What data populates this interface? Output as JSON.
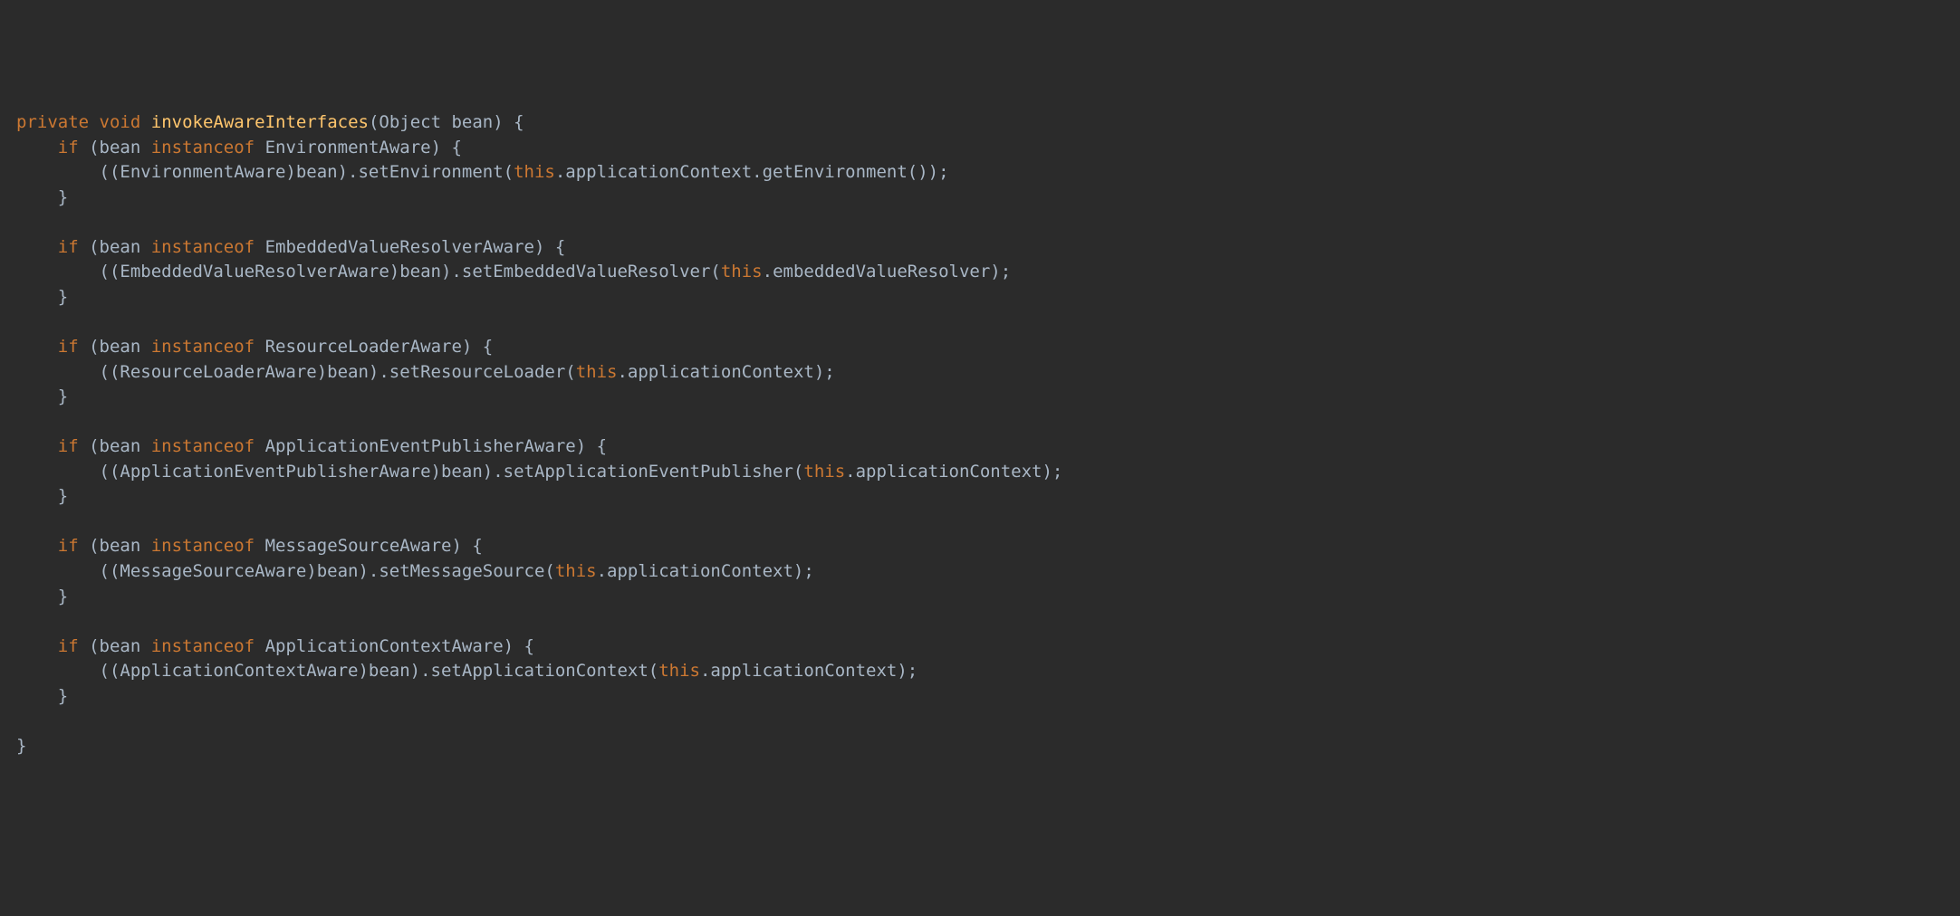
{
  "colors": {
    "background": "#2b2b2b",
    "default_text": "#a9b7c6",
    "keyword": "#cc7832",
    "method_decl": "#ffc66d",
    "indent_guide": "#444444"
  },
  "code": {
    "tokens": [
      [
        {
          "t": "private",
          "c": "kw-modifier"
        },
        {
          "t": " "
        },
        {
          "t": "void",
          "c": "kw-type"
        },
        {
          "t": " "
        },
        {
          "t": "invokeAwareInterfaces",
          "c": "method-decl"
        },
        {
          "t": "(Object bean) {"
        }
      ],
      [
        {
          "t": "    "
        },
        {
          "t": "if",
          "c": "kw-control"
        },
        {
          "t": " (bean "
        },
        {
          "t": "instanceof",
          "c": "kw-control"
        },
        {
          "t": " EnvironmentAware) {"
        }
      ],
      [
        {
          "t": "        ((EnvironmentAware)bean).setEnvironment("
        },
        {
          "t": "this",
          "c": "kw-this"
        },
        {
          "t": ".applicationContext.getEnvironment());"
        }
      ],
      [
        {
          "t": "    }"
        }
      ],
      [
        {
          "t": ""
        }
      ],
      [
        {
          "t": "    "
        },
        {
          "t": "if",
          "c": "kw-control"
        },
        {
          "t": " (bean "
        },
        {
          "t": "instanceof",
          "c": "kw-control"
        },
        {
          "t": " EmbeddedValueResolverAware) {"
        }
      ],
      [
        {
          "t": "        ((EmbeddedValueResolverAware)bean).setEmbeddedValueResolver("
        },
        {
          "t": "this",
          "c": "kw-this"
        },
        {
          "t": ".embeddedValueResolver);"
        }
      ],
      [
        {
          "t": "    }"
        }
      ],
      [
        {
          "t": ""
        }
      ],
      [
        {
          "t": "    "
        },
        {
          "t": "if",
          "c": "kw-control"
        },
        {
          "t": " (bean "
        },
        {
          "t": "instanceof",
          "c": "kw-control"
        },
        {
          "t": " ResourceLoaderAware) {"
        }
      ],
      [
        {
          "t": "        ((ResourceLoaderAware)bean).setResourceLoader("
        },
        {
          "t": "this",
          "c": "kw-this"
        },
        {
          "t": ".applicationContext);"
        }
      ],
      [
        {
          "t": "    }"
        }
      ],
      [
        {
          "t": ""
        }
      ],
      [
        {
          "t": "    "
        },
        {
          "t": "if",
          "c": "kw-control"
        },
        {
          "t": " (bean "
        },
        {
          "t": "instanceof",
          "c": "kw-control"
        },
        {
          "t": " ApplicationEventPublisherAware) {"
        }
      ],
      [
        {
          "t": "        ((ApplicationEventPublisherAware)bean).setApplicationEventPublisher("
        },
        {
          "t": "this",
          "c": "kw-this"
        },
        {
          "t": ".applicationContext);"
        }
      ],
      [
        {
          "t": "    }"
        }
      ],
      [
        {
          "t": ""
        }
      ],
      [
        {
          "t": "    "
        },
        {
          "t": "if",
          "c": "kw-control"
        },
        {
          "t": " (bean "
        },
        {
          "t": "instanceof",
          "c": "kw-control"
        },
        {
          "t": " MessageSourceAware) {"
        }
      ],
      [
        {
          "t": "        ((MessageSourceAware)bean).setMessageSource("
        },
        {
          "t": "this",
          "c": "kw-this"
        },
        {
          "t": ".applicationContext);"
        }
      ],
      [
        {
          "t": "    }"
        }
      ],
      [
        {
          "t": ""
        }
      ],
      [
        {
          "t": "    "
        },
        {
          "t": "if",
          "c": "kw-control"
        },
        {
          "t": " (bean "
        },
        {
          "t": "instanceof",
          "c": "kw-control"
        },
        {
          "t": " ApplicationContextAware) {"
        }
      ],
      [
        {
          "t": "        ((ApplicationContextAware)bean).setApplicationContext("
        },
        {
          "t": "this",
          "c": "kw-this"
        },
        {
          "t": ".applicationContext);"
        }
      ],
      [
        {
          "t": "    }"
        }
      ],
      [
        {
          "t": ""
        }
      ],
      [
        {
          "t": "}"
        }
      ]
    ]
  }
}
